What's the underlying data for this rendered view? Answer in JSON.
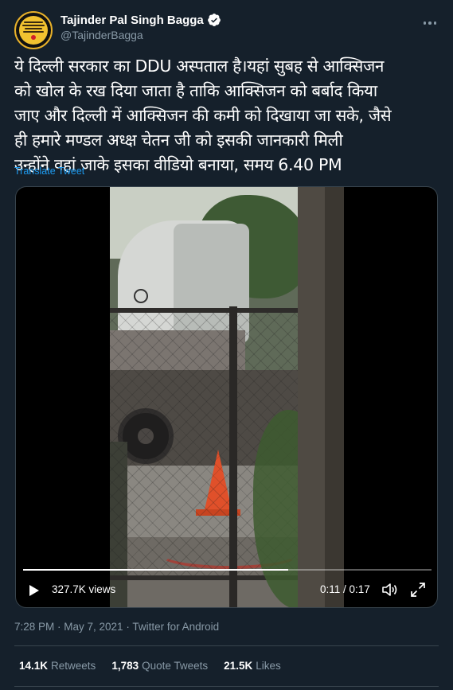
{
  "author": {
    "display_name": "Tajinder Pal Singh Bagga",
    "handle": "@TajinderBagga",
    "verified": true,
    "avatar_icon": "profile-avatar",
    "accent": "#1d9bf0"
  },
  "tweet": {
    "text": "ये दिल्ली सरकार का DDU अस्पताल है।यहां सुबह से आक्सिजन\nको खोल के रख दिया जाता है ताकि आक्सिजन को बर्बाद किया\nजाए और दिल्ली में आक्सिजन की कमी को दिखाया जा सके, जैसे\nही हमारे मण्डल अध्क्ष चेतन जी को इसकी जानकारी मिली\nउन्होंने वहां जाके इसका वीडियो बनाया, समय 6.40 PM",
    "translate_label": "Translate Tweet"
  },
  "video": {
    "views": "327.7K views",
    "timecode": "0:11 / 0:17",
    "progress_fraction": 0.65,
    "play_icon": "play-icon",
    "volume_icon": "volume-icon",
    "fullscreen_icon": "fullscreen-icon"
  },
  "meta": {
    "timestamp": "7:28 PM · May 7, 2021 · Twitter for Android"
  },
  "stats": [
    {
      "value": "14.1K",
      "label": "Retweets"
    },
    {
      "value": "1,783",
      "label": "Quote Tweets"
    },
    {
      "value": "21.5K",
      "label": "Likes"
    }
  ],
  "colors": {
    "background": "#15202b",
    "secondary_text": "#8899a6",
    "divider": "#38444d",
    "link": "#1d9bf0"
  }
}
